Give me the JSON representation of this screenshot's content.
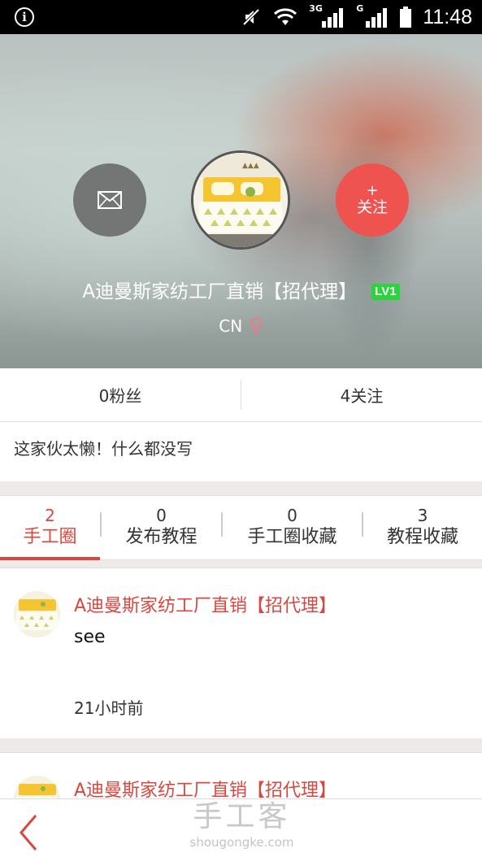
{
  "status_bar": {
    "time": "11:48",
    "network_1": "3G",
    "network_2": "G"
  },
  "profile": {
    "username": "A迪曼斯家纺工厂直销【招代理】",
    "level_badge": "LV1",
    "region": "CN",
    "gender_symbol": "♀",
    "follow_plus": "+",
    "follow_label": "关注",
    "accent_color": "#ef5350"
  },
  "stats": {
    "fans": "0粉丝",
    "following": "4关注"
  },
  "bio": "这家伙太懒！什么都没写",
  "tabs": [
    {
      "count": "2",
      "name": "手工圈",
      "active": true
    },
    {
      "count": "0",
      "name": "发布教程",
      "active": false
    },
    {
      "count": "0",
      "name": "手工圈收藏",
      "active": false
    },
    {
      "count": "3",
      "name": "教程收藏",
      "active": false
    }
  ],
  "posts": [
    {
      "author": "A迪曼斯家纺工厂直销【招代理】",
      "content": "see",
      "time": "21小时前"
    },
    {
      "author": "A迪曼斯家纺工厂直销【招代理】",
      "content": "",
      "time": ""
    }
  ],
  "bottom_bar": {
    "watermark_cn": "手工客",
    "watermark_en": "shougongke.com"
  }
}
